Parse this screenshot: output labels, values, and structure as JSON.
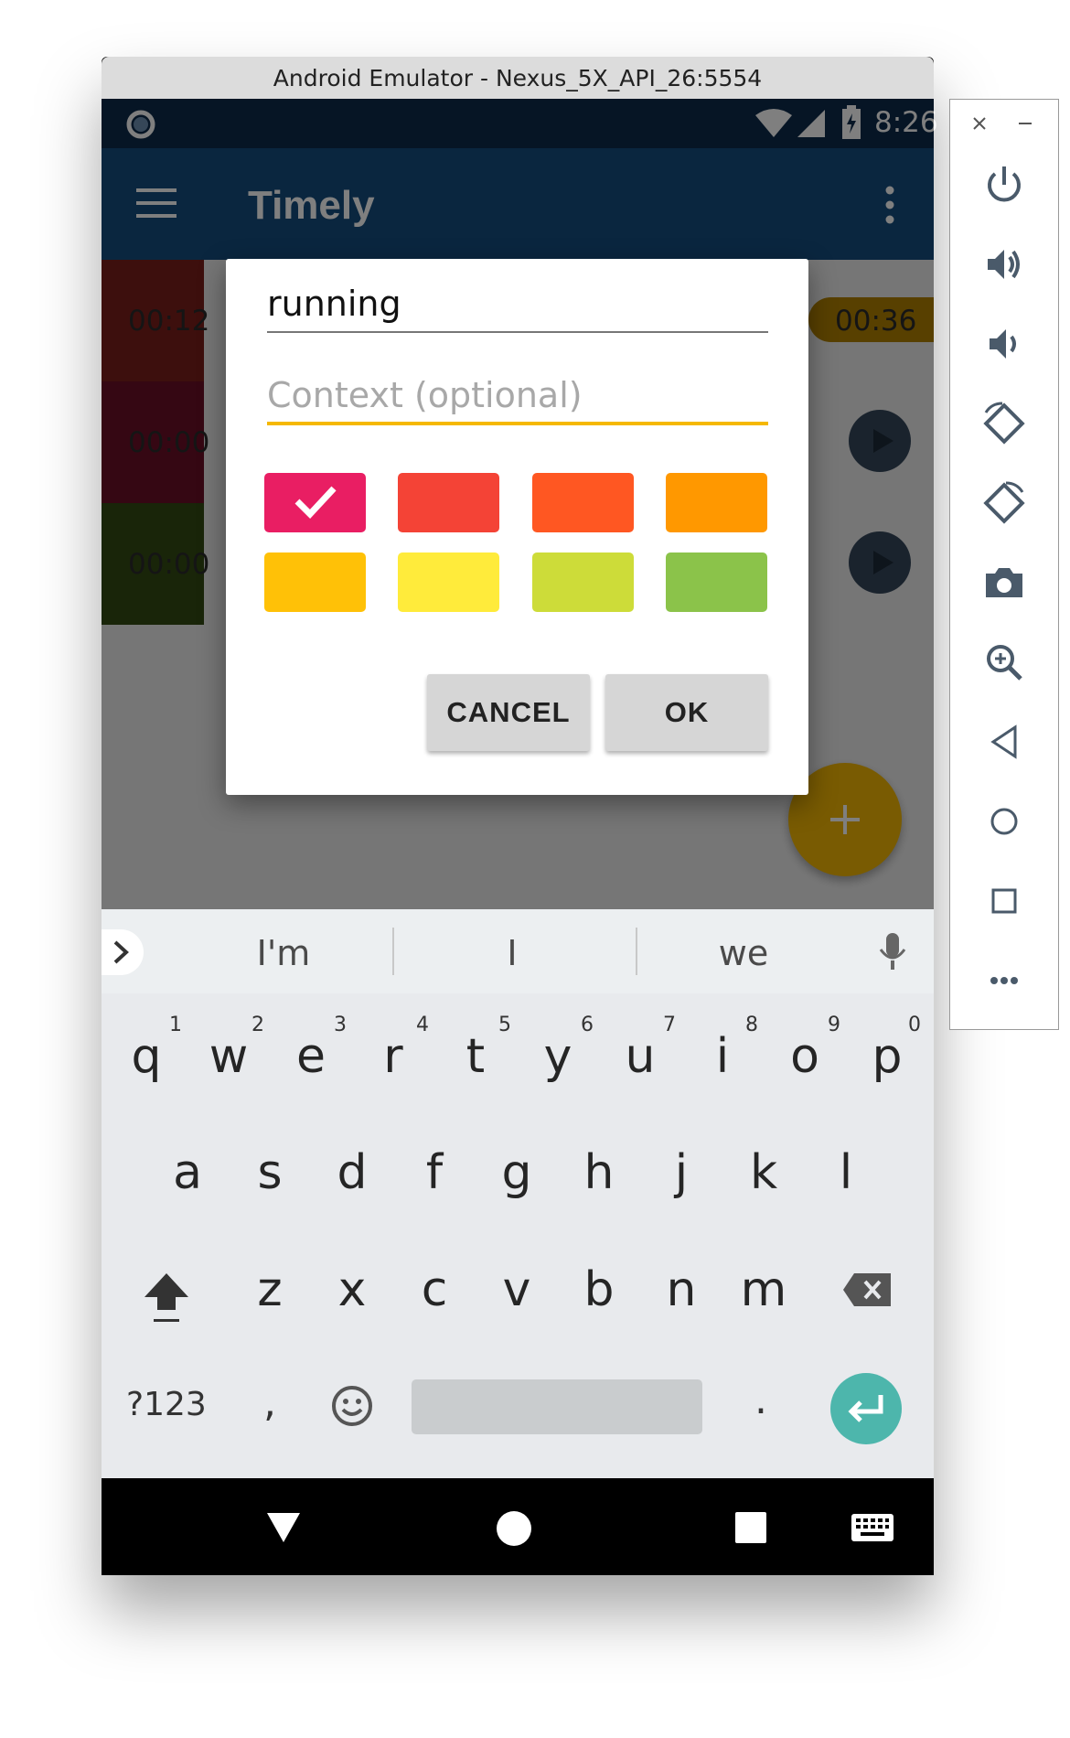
{
  "window": {
    "title": "Android Emulator - Nexus_5X_API_26:5554"
  },
  "status_bar": {
    "time": "8:26"
  },
  "app_bar": {
    "title": "Timely"
  },
  "timers": [
    {
      "time": "00:12",
      "color": "#7a1f1b"
    },
    {
      "time": "00:00",
      "color": "#6b0f27"
    },
    {
      "time": "00:00",
      "color": "#334b13"
    }
  ],
  "timer_right": {
    "time": "00:36",
    "color": "#b08000"
  },
  "dialog": {
    "name_value": "running",
    "context_placeholder": "Context (optional)",
    "swatches": [
      "#e91e63",
      "#f44336",
      "#ff5722",
      "#ff9800",
      "#ffc107",
      "#ffeb3b",
      "#cddc39",
      "#8bc34a"
    ],
    "selected_swatch": 0,
    "cancel_label": "CANCEL",
    "ok_label": "OK"
  },
  "fab": {
    "icon": "plus-icon",
    "color": "#f2b705"
  },
  "keyboard": {
    "suggestions": [
      "I'm",
      "I",
      "we"
    ],
    "row1": [
      "q",
      "w",
      "e",
      "r",
      "t",
      "y",
      "u",
      "i",
      "o",
      "p"
    ],
    "row1_hints": [
      "1",
      "2",
      "3",
      "4",
      "5",
      "6",
      "7",
      "8",
      "9",
      "0"
    ],
    "row2": [
      "a",
      "s",
      "d",
      "f",
      "g",
      "h",
      "j",
      "k",
      "l"
    ],
    "row3": [
      "z",
      "x",
      "c",
      "v",
      "b",
      "n",
      "m"
    ],
    "symbols_label": "?123",
    "comma": ",",
    "period": "."
  },
  "emulator_controls": [
    "close-icon",
    "minimize-icon",
    "power-icon",
    "volume-up-icon",
    "volume-down-icon",
    "rotate-left-icon",
    "rotate-right-icon",
    "camera-icon",
    "zoom-icon",
    "back-icon",
    "home-icon",
    "overview-icon",
    "more-icon"
  ]
}
